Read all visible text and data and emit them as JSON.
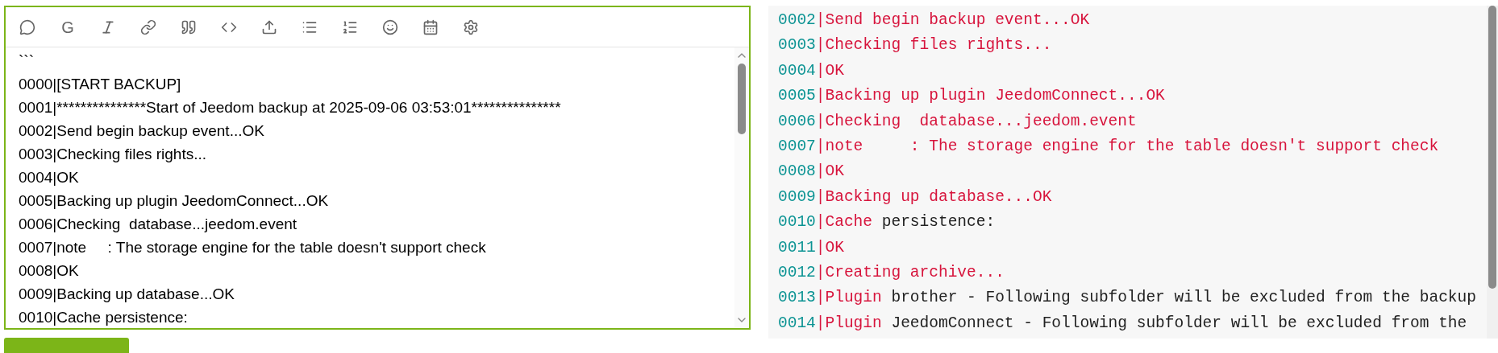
{
  "editor": {
    "toolbar": {
      "letter_button": "G"
    },
    "text": "```\n0000|[START BACKUP]\n0001|***************Start of Jeedom backup at 2025-09-06 03:53:01***************\n0002|Send begin backup event...OK\n0003|Checking files rights...\n0004|OK\n0005|Backing up plugin JeedomConnect...OK\n0006|Checking  database...jeedom.event\n0007|note     : The storage engine for the table doesn't support check\n0008|OK\n0009|Backing up database...OK\n0010|Cache persistence:"
  },
  "preview": {
    "lines": [
      {
        "number": "0002",
        "separator": "|",
        "segments": [
          {
            "kind": "keyword",
            "text": "Send begin backup event...OK"
          }
        ]
      },
      {
        "number": "0003",
        "separator": "|",
        "segments": [
          {
            "kind": "keyword",
            "text": "Checking files rights..."
          }
        ]
      },
      {
        "number": "0004",
        "separator": "|",
        "segments": [
          {
            "kind": "keyword",
            "text": "OK"
          }
        ]
      },
      {
        "number": "0005",
        "separator": "|",
        "segments": [
          {
            "kind": "keyword",
            "text": "Backing up plugin JeedomConnect...OK"
          }
        ]
      },
      {
        "number": "0006",
        "separator": "|",
        "segments": [
          {
            "kind": "keyword",
            "text": "Checking  database...jeedom.event"
          }
        ]
      },
      {
        "number": "0007",
        "separator": "|",
        "segments": [
          {
            "kind": "keyword",
            "text": "note     : The storage engine for the table doesn't support check"
          }
        ]
      },
      {
        "number": "0008",
        "separator": "|",
        "segments": [
          {
            "kind": "keyword",
            "text": "OK"
          }
        ]
      },
      {
        "number": "0009",
        "separator": "|",
        "segments": [
          {
            "kind": "keyword",
            "text": "Backing up database...OK"
          }
        ]
      },
      {
        "number": "0010",
        "separator": "|",
        "segments": [
          {
            "kind": "keyword",
            "text": "Cache"
          },
          {
            "kind": "plain",
            "text": " persistence:"
          }
        ]
      },
      {
        "number": "0011",
        "separator": "|",
        "segments": [
          {
            "kind": "keyword",
            "text": "OK"
          }
        ]
      },
      {
        "number": "0012",
        "separator": "|",
        "segments": [
          {
            "kind": "keyword",
            "text": "Creating archive..."
          }
        ]
      },
      {
        "number": "0013",
        "separator": "|",
        "segments": [
          {
            "kind": "keyword",
            "text": "Plugin"
          },
          {
            "kind": "plain",
            "text": " brother - Following subfolder will be excluded from the backup"
          }
        ]
      },
      {
        "number": "0014",
        "separator": "|",
        "segments": [
          {
            "kind": "keyword",
            "text": "Plugin"
          },
          {
            "kind": "plain",
            "text": " JeedomConnect - Following subfolder will be excluded from the"
          }
        ]
      }
    ]
  }
}
